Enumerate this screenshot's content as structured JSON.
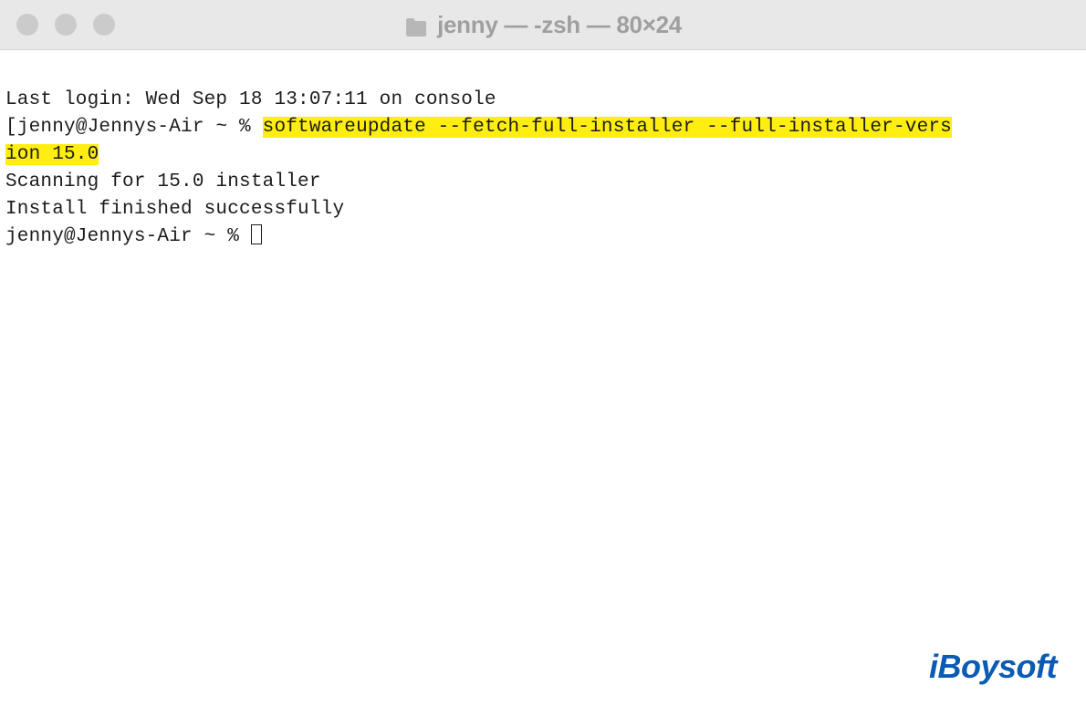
{
  "titlebar": {
    "title": "jenny — -zsh — 80×24"
  },
  "terminal": {
    "last_login": "Last login: Wed Sep 18 13:07:11 on console",
    "prompt1_prefix_bracket": "[",
    "prompt1_user_host": "jenny@Jennys-Air ~ % ",
    "command_part1": "softwareupdate --fetch-full-installer --full-installer-vers",
    "command_part2": "ion 15.0",
    "output_line1": "Scanning for 15.0 installer",
    "output_line2": "Install finished successfully",
    "prompt2": "jenny@Jennys-Air ~ % "
  },
  "watermark": {
    "text": "iBoysoft"
  }
}
